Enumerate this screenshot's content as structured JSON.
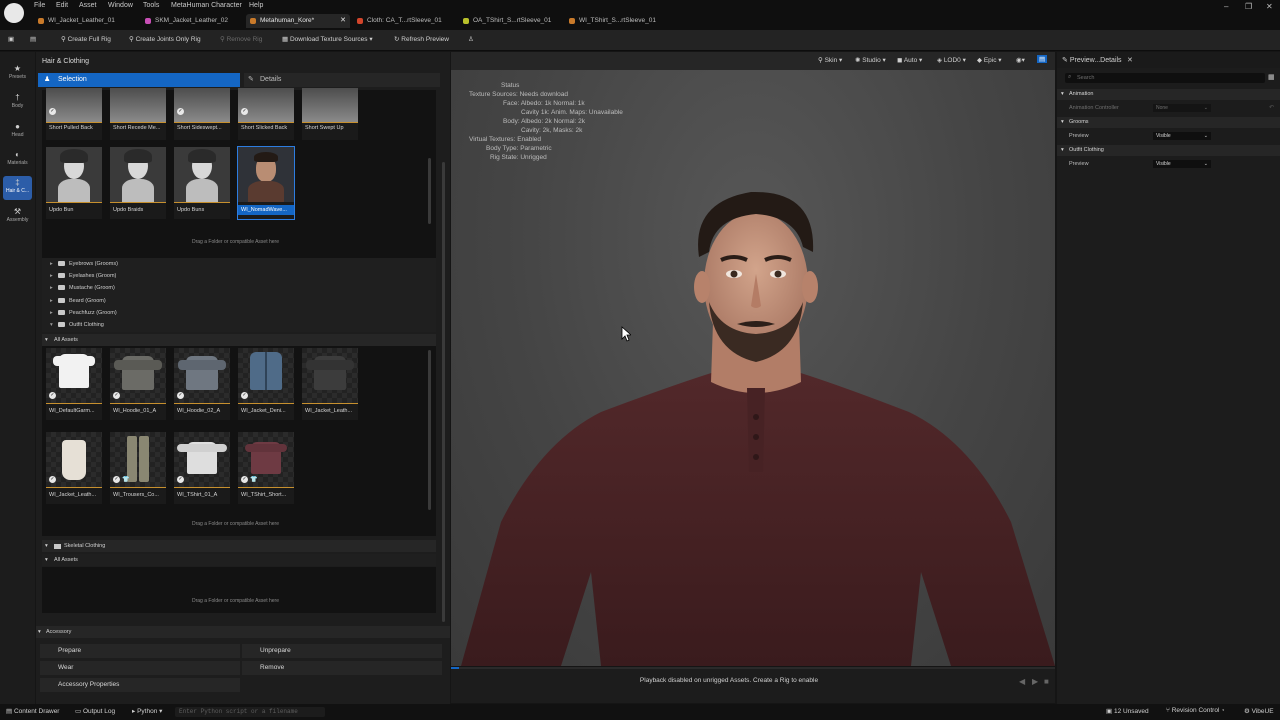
{
  "menu": [
    "File",
    "Edit",
    "Asset",
    "Window",
    "Tools",
    "MetaHuman Character",
    "Help"
  ],
  "doc_tabs": [
    {
      "label": "WI_Jacket_Leather_01",
      "color": "#c97a2a"
    },
    {
      "label": "SKM_Jacket_Leather_02",
      "color": "#c84fb6"
    },
    {
      "label": "Metahuman_Kore*",
      "color": "#c97a2a"
    },
    {
      "label": "Cloth: CA_T...rtSleeve_01",
      "color": "#d2452b"
    },
    {
      "label": "OA_TShirt_S...rtSleeve_01",
      "color": "#b9c12b"
    },
    {
      "label": "WI_TShirt_S...rtSleeve_01",
      "color": "#c97a2a"
    }
  ],
  "toolbar": {
    "create_full_rig": "Create Full Rig",
    "create_joints_only_rig": "Create Joints Only Rig",
    "remove_rig": "Remove Rig",
    "download_texture_sources": "Download Texture Sources ▾",
    "refresh_preview": "Refresh Preview"
  },
  "rail": [
    {
      "label": "Presets",
      "icon": "★"
    },
    {
      "label": "Body",
      "icon": "†"
    },
    {
      "label": "Head",
      "icon": "●"
    },
    {
      "label": "Materials",
      "icon": "◐"
    },
    {
      "label": "Hair & C...",
      "icon": "‡"
    },
    {
      "label": "Assembly",
      "icon": "⚒"
    }
  ],
  "panel": {
    "title": "Hair & Clothing",
    "selection_tab": "Selection",
    "details_tab": "Details",
    "hair_tiles_row1": [
      "Short Pulled Back",
      "Short Recede Me...",
      "Short Sideswept...",
      "Short Slicked Back",
      "Short Swept Up"
    ],
    "hair_tiles_row2": [
      "Updo Bun",
      "Updo Braids",
      "Updo Buns",
      "WI_NomadWave..."
    ],
    "drop_hint": "Drag a Folder or compatible Asset here",
    "groom_categories": [
      "Eyebrows (Grooms)",
      "Eyelashes (Groom)",
      "Mustache (Groom)",
      "Beard (Groom)",
      "Peachfuzz (Groom)",
      "Outfit Clothing"
    ],
    "all_assets": "All Assets",
    "outfit_row1": [
      "WI_DefaultGarm...",
      "WI_Hoodie_01_A",
      "WI_Hoodie_02_A",
      "WI_Jacket_Deni...",
      "WI_Jacket_Leath..."
    ],
    "outfit_row2": [
      "WI_Jacket_Leath...",
      "WI_Trousers_Co...",
      "WI_TShirt_01_A",
      "WI_TShirt_Short..."
    ],
    "skeletal_clothing": "Skeletal Clothing",
    "accessory": "Accessory",
    "prepare": "Prepare",
    "unprepare": "Unprepare",
    "wear": "Wear",
    "remove": "Remove",
    "accessory_properties": "Accessory Properties"
  },
  "viewport": {
    "skin": "Skin ▾",
    "studio": "Studio ▾",
    "auto": "Auto ▾",
    "lod": "LOD0 ▾",
    "epic": "Epic ▾",
    "status_lines": [
      {
        "k": "Status",
        "v": ""
      },
      {
        "k": "Texture Sources:",
        "v": "Needs download"
      },
      {
        "k": "Face:",
        "v": "Albedo: 1k Normal: 1k"
      },
      {
        "k": "",
        "v": "Cavity 1k: Anim. Maps: Unavailable"
      },
      {
        "k": "Body:",
        "v": "Albedo: 2k Normal: 2k"
      },
      {
        "k": "",
        "v": "Cavity: 2k, Masks: 2k"
      },
      {
        "k": "Virtual Textures:",
        "v": "Enabled"
      },
      {
        "k": "Body Type:",
        "v": "Parametric"
      },
      {
        "k": "Rig State:",
        "v": "Unrigged"
      }
    ],
    "playback_msg": "Playback disabled on unrigged Assets. Create a Rig to enable"
  },
  "details": {
    "tab": "Preview...Details",
    "search_placeholder": "Search",
    "animation": "Animation",
    "animation_controller": "Animation Controller",
    "animation_controller_value": "None",
    "grooms": "Grooms",
    "preview": "Preview",
    "grooms_preview_value": "Visible",
    "outfit_clothing": "Outfit Clothing",
    "outfit_preview_value": "Visible"
  },
  "bottombar": {
    "content_drawer": "Content Drawer",
    "output_log": "Output Log",
    "python": "Python ▾",
    "cmd_placeholder": "Enter Python script or a filename",
    "unsaved": "12 Unsaved",
    "revision_control": "Revision Control ▾",
    "vibeue": "VibeUE"
  },
  "colors": {
    "accent": "#1466c4",
    "shirt": "#4a2323",
    "skin": "#c99a82",
    "hair": "#231a15"
  }
}
